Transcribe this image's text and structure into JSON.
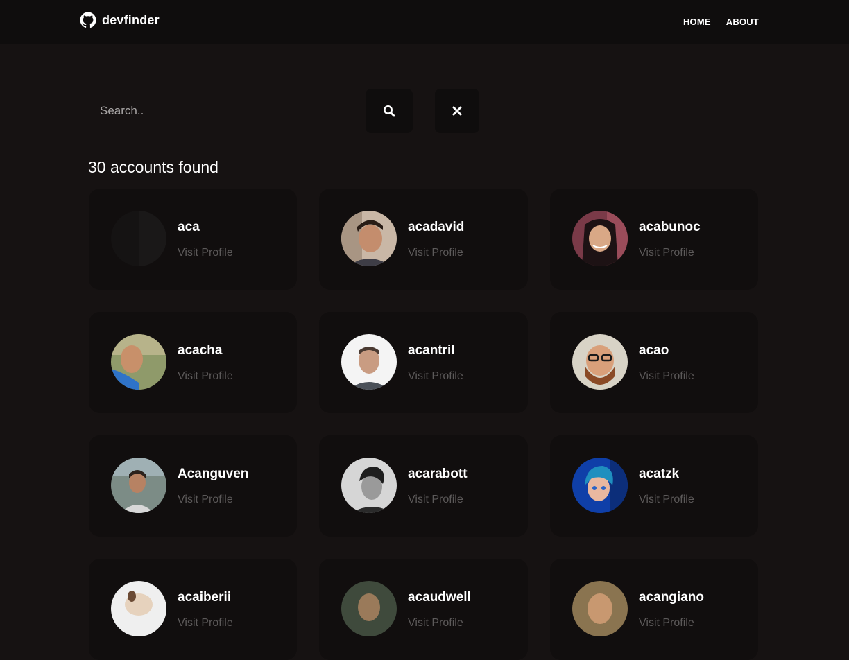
{
  "header": {
    "brand": "devfinder",
    "brand_icon": "github-icon",
    "nav": [
      "HOME",
      "ABOUT"
    ]
  },
  "search": {
    "placeholder": "Search..",
    "value": "",
    "search_icon": "search-icon",
    "clear_icon": "close-icon"
  },
  "results": {
    "count_text": "30 accounts found",
    "visit_label": "Visit Profile",
    "users": [
      {
        "username": "aca"
      },
      {
        "username": "acadavid"
      },
      {
        "username": "acabunoc"
      },
      {
        "username": "acacha"
      },
      {
        "username": "acantril"
      },
      {
        "username": "acao"
      },
      {
        "username": "Acanguven"
      },
      {
        "username": "acarabott"
      },
      {
        "username": "acatzk"
      },
      {
        "username": "acaiberii"
      },
      {
        "username": "acaudwell"
      },
      {
        "username": "acangiano"
      }
    ]
  }
}
